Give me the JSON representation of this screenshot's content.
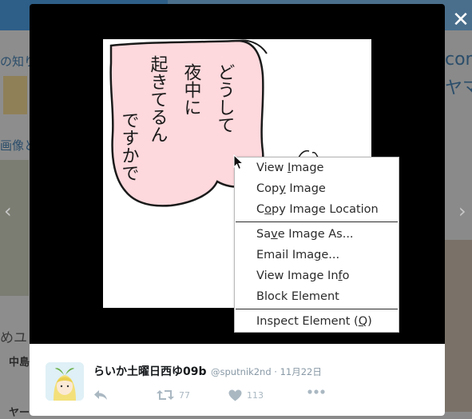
{
  "background": {
    "snippets": [
      {
        "text": "の知り",
        "color": "#2a4d6a"
      },
      {
        "text": "画像と",
        "color": "#2a4d6a"
      },
      {
        "text": "めユ",
        "color": "#3a3a3a"
      },
      {
        "text": "中島",
        "color": "#2a2a2a"
      },
      {
        "text": "ヤー",
        "color": "#2a2a2a"
      },
      {
        "text": "com",
        "color": "#2a4d6a"
      },
      {
        "text": "ヤマ",
        "color": "#2a4d6a"
      }
    ]
  },
  "nav": {
    "prev_glyph": "‹",
    "next_glyph": "›"
  },
  "modal": {
    "close_glyph": "✕",
    "image": {
      "balloon_text_columns": [
        "どうして",
        "夜中に",
        "起きてるん",
        "ですかで"
      ]
    }
  },
  "tweet": {
    "display_name": "らいか土曜日西ゆ09b",
    "handle": "@sputnik2nd",
    "separator": "·",
    "date": "11月22日",
    "retweet_count": "77",
    "like_count": "113"
  },
  "context_menu": {
    "items": [
      {
        "label": "View Image",
        "access_key": "I"
      },
      {
        "label": "Copy Image",
        "access_key": "y"
      },
      {
        "label": "Copy Image Location",
        "access_key": "o"
      },
      {
        "label": "Save Image As...",
        "access_key": "v"
      },
      {
        "label": "Email Image...",
        "access_key": "g"
      },
      {
        "label": "View Image Info",
        "access_key": "f"
      },
      {
        "label": "Block Element",
        "access_key": ""
      },
      {
        "label": "Inspect Element (Q)",
        "access_key": "Q"
      }
    ]
  },
  "colors": {
    "overlay": "#000000",
    "balloon_fill": "#fdd8dc",
    "icon_gray": "#aab8c2"
  }
}
